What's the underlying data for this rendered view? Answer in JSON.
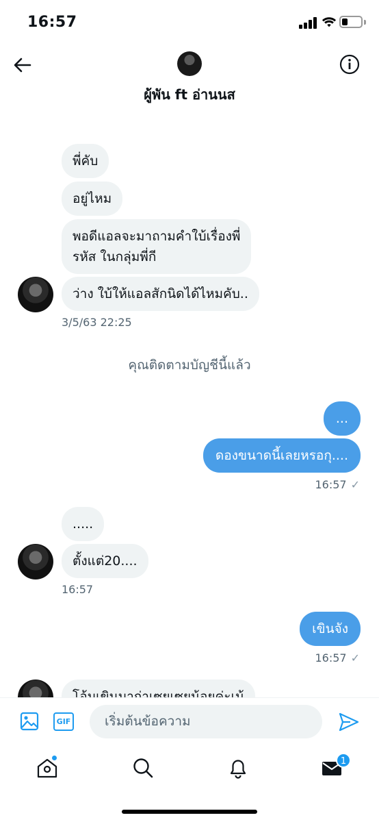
{
  "status_bar": {
    "time": "16:57"
  },
  "header": {
    "title": "ผู้พัน ft อ่านนส"
  },
  "incoming_group_1": {
    "messages": [
      "พี่คับ",
      "อยู่ไหม",
      "พอดีแอลจะมาถามคำใบ้เรื่องพี่\nรหัส ในกลุ่มพี่กี",
      "ว่าง ใบ้ให้แอลสักนิดได้ไหมคับ.."
    ],
    "timestamp": "3/5/63 22:25"
  },
  "follow_note": "คุณติดตามบัญชีนี้แล้ว",
  "outgoing_group_1": {
    "messages": [
      "...",
      "ดองขนาดนี้เลยหรอกุ...."
    ],
    "timestamp": "16:57"
  },
  "incoming_group_2": {
    "messages": [
      ".....",
      "ตั้งแต่20...."
    ],
    "timestamp": "16:57"
  },
  "outgoing_group_2": {
    "messages": [
      "เขินจัง"
    ],
    "timestamp": "16:57"
  },
  "incoming_partial": {
    "text": "โอ้มเขินมาก่าเซยเซยน้อยค่ะเน้"
  },
  "composer": {
    "gif_label": "GIF",
    "placeholder": "เริ่มต้นข้อความ"
  },
  "tabbar": {
    "messages_badge": "1"
  },
  "colors": {
    "accent": "#1d9bf0",
    "outgoing_bubble": "#4a9ee8",
    "incoming_bubble": "#eff3f4",
    "muted": "#536471"
  },
  "icons": {
    "back": "arrow-left-icon",
    "info": "info-icon",
    "image": "image-icon",
    "send": "send-icon",
    "home": "home-icon",
    "search": "search-icon",
    "notifications": "bell-icon",
    "messages": "envelope-icon"
  }
}
